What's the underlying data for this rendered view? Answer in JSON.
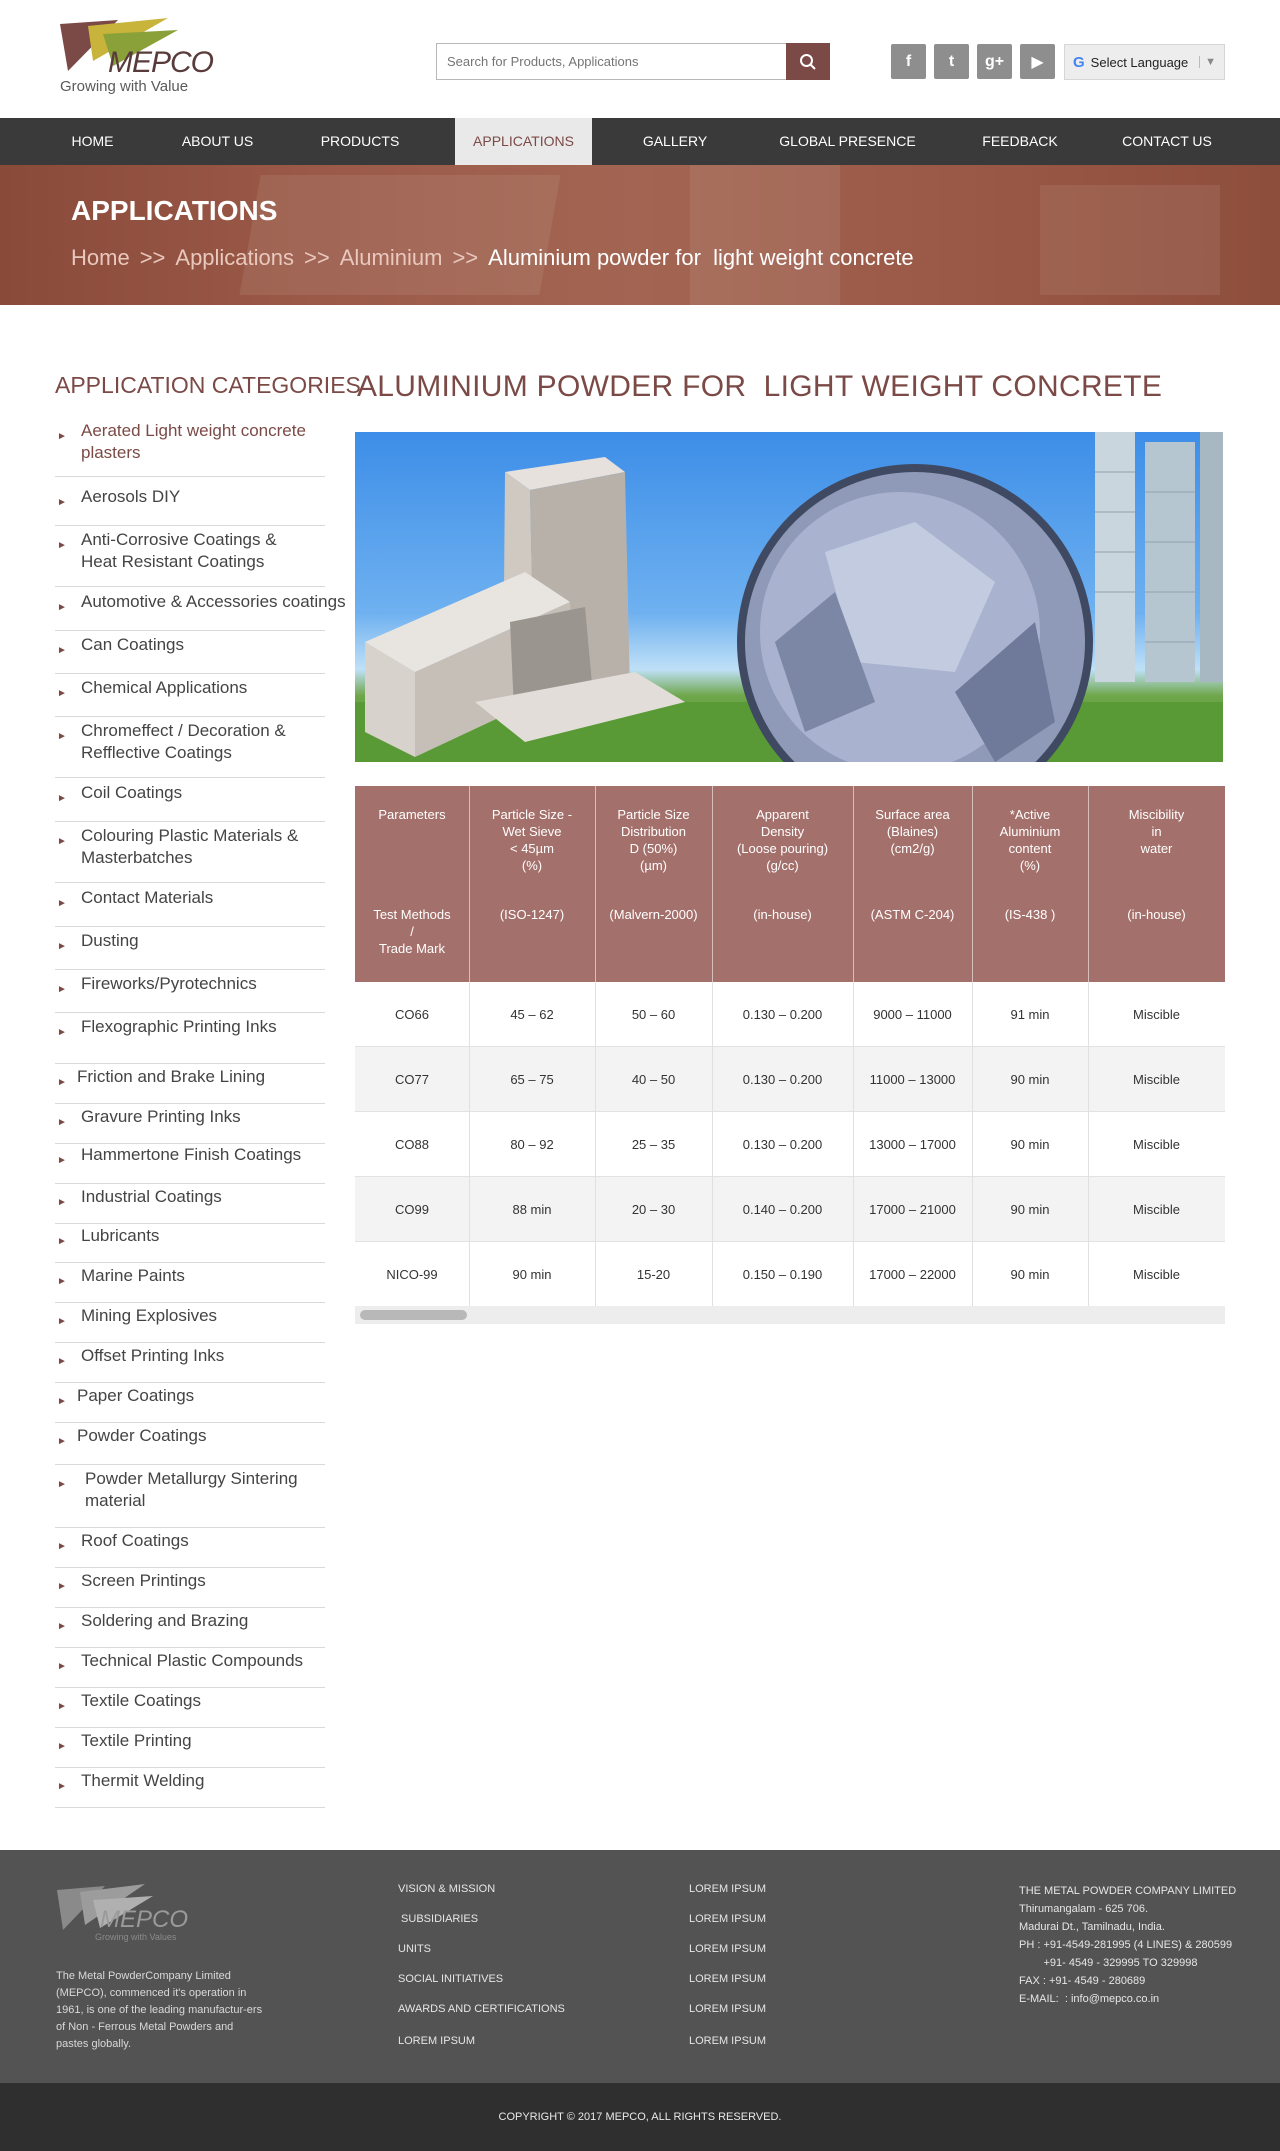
{
  "header": {
    "logo_text": "MEPCO",
    "logo_tagline": "Growing with Value",
    "search_placeholder": "Search for Products, Applications",
    "social": [
      "facebook-icon",
      "twitter-icon",
      "google-plus-icon",
      "youtube-icon"
    ],
    "social_glyphs": [
      "f",
      "t",
      "g+",
      "▶"
    ],
    "language_label": "Select Language"
  },
  "nav": {
    "items": [
      "HOME",
      "ABOUT US",
      "PRODUCTS",
      "APPLICATIONS",
      "GALLERY",
      "GLOBAL PRESENCE",
      "FEEDBACK",
      "CONTACT US"
    ],
    "active": "APPLICATIONS"
  },
  "banner": {
    "title": "APPLICATIONS",
    "breadcrumb": [
      "Home",
      "Applications",
      "Aluminium",
      "Aluminium powder for  light weight concrete"
    ],
    "separator": ">>"
  },
  "sidebar": {
    "title": "APPLICATION CATEGORIES",
    "items": [
      "Aerated Light weight concrete plasters",
      "Aerosols DIY",
      "Anti-Corrosive Coatings & Heat Resistant Coatings",
      "Automotive & Accessories coatings",
      "Can Coatings",
      "Chemical Applications",
      "Chromeffect / Decoration & Refflective Coatings",
      "Coil Coatings",
      "Colouring Plastic Materials & Masterbatches",
      "Contact Materials",
      "Dusting",
      "Fireworks/Pyrotechnics",
      "Flexographic Printing Inks",
      "Friction and Brake Lining",
      "Gravure Printing Inks",
      "Hammertone Finish Coatings",
      "Industrial Coatings",
      "Lubricants",
      "Marine Paints",
      "Mining Explosives",
      "Offset Printing Inks",
      "Paper Coatings",
      "Powder Coatings",
      "Powder Metallurgy Sintering material",
      "Roof Coatings",
      "Screen Printings",
      "Soldering and Brazing",
      "Technical Plastic Compounds",
      "Textile Coatings",
      "Textile Printing",
      "Thermit Welding"
    ],
    "active_index": 0
  },
  "main": {
    "title": "ALUMINIUM POWDER FOR  LIGHT WEIGHT CONCRETE",
    "table": {
      "headers": [
        "Parameters",
        "Particle Size -\nWet Sieve\n< 45µm\n(%)",
        "Particle Size\nDistribution\nD (50%)\n(µm)",
        "Apparent\nDensity\n(Loose pouring)\n(g/cc)",
        "Surface area\n(Blaines)\n(cm2/g)",
        "*Active\nAluminium\ncontent\n(%)",
        "Miscibility\nin\nwater"
      ],
      "methods": [
        "Test Methods\n/\nTrade Mark",
        "(ISO-1247)",
        "(Malvern-2000)",
        "(in-house)",
        "(ASTM C-204)",
        "(IS-438 )",
        "(in-house)"
      ],
      "rows": [
        [
          "CO66",
          "45 – 62",
          "50 – 60",
          "0.130 – 0.200",
          "9000 – 11000",
          "91 min",
          "Miscible"
        ],
        [
          "CO77",
          "65 – 75",
          "40 – 50",
          "0.130 – 0.200",
          "11000 – 13000",
          "90 min",
          "Miscible"
        ],
        [
          "CO88",
          "80 – 92",
          "25 – 35",
          "0.130 – 0.200",
          "13000 – 17000",
          "90 min",
          "Miscible"
        ],
        [
          "CO99",
          "88 min",
          "20 – 30",
          "0.140 – 0.200",
          "17000 – 21000",
          "90 min",
          "Miscible"
        ],
        [
          "NICO-99",
          "90 min",
          "15-20",
          "0.150 – 0.190",
          "17000 – 22000",
          "90 min",
          "Miscible"
        ]
      ]
    }
  },
  "footer": {
    "logo_text": "MEPCO",
    "logo_tagline": "Growing with Values",
    "description": "The Metal PowderCompany Limited (MEPCO), commenced it's operation in 1961, is one of the leading manufactur-ers of Non - Ferrous Metal Powders and pastes globally.",
    "col1": [
      "VISION & MISSION",
      " SUBSIDIARIES",
      "UNITS",
      "SOCIAL INITIATIVES",
      "AWARDS AND CERTIFICATIONS",
      "LOREM IPSUM"
    ],
    "col2": [
      "LOREM IPSUM",
      "LOREM IPSUM",
      "LOREM IPSUM",
      "LOREM IPSUM",
      "LOREM IPSUM",
      "LOREM IPSUM"
    ],
    "contact": "THE METAL POWDER COMPANY LIMITED\nThirumangalam - 625 706.\nMadurai Dt., Tamilnadu, India.\nPH : +91-4549-281995 (4 LINES) & 280599\n        +91- 4549 - 329995 TO 329998\nFAX : +91- 4549 - 280689\nE-MAIL:  : info@mepco.co.in",
    "copyright": "COPYRIGHT © 2017 MEPCO, ALL RIGHTS RESERVED."
  },
  "colors": {
    "brand": "#7b4a46",
    "nav_bg": "#3a3a3a",
    "table_head": "#a4706b",
    "footer_bg": "#535353",
    "copy_bg": "#2f2f2f"
  }
}
